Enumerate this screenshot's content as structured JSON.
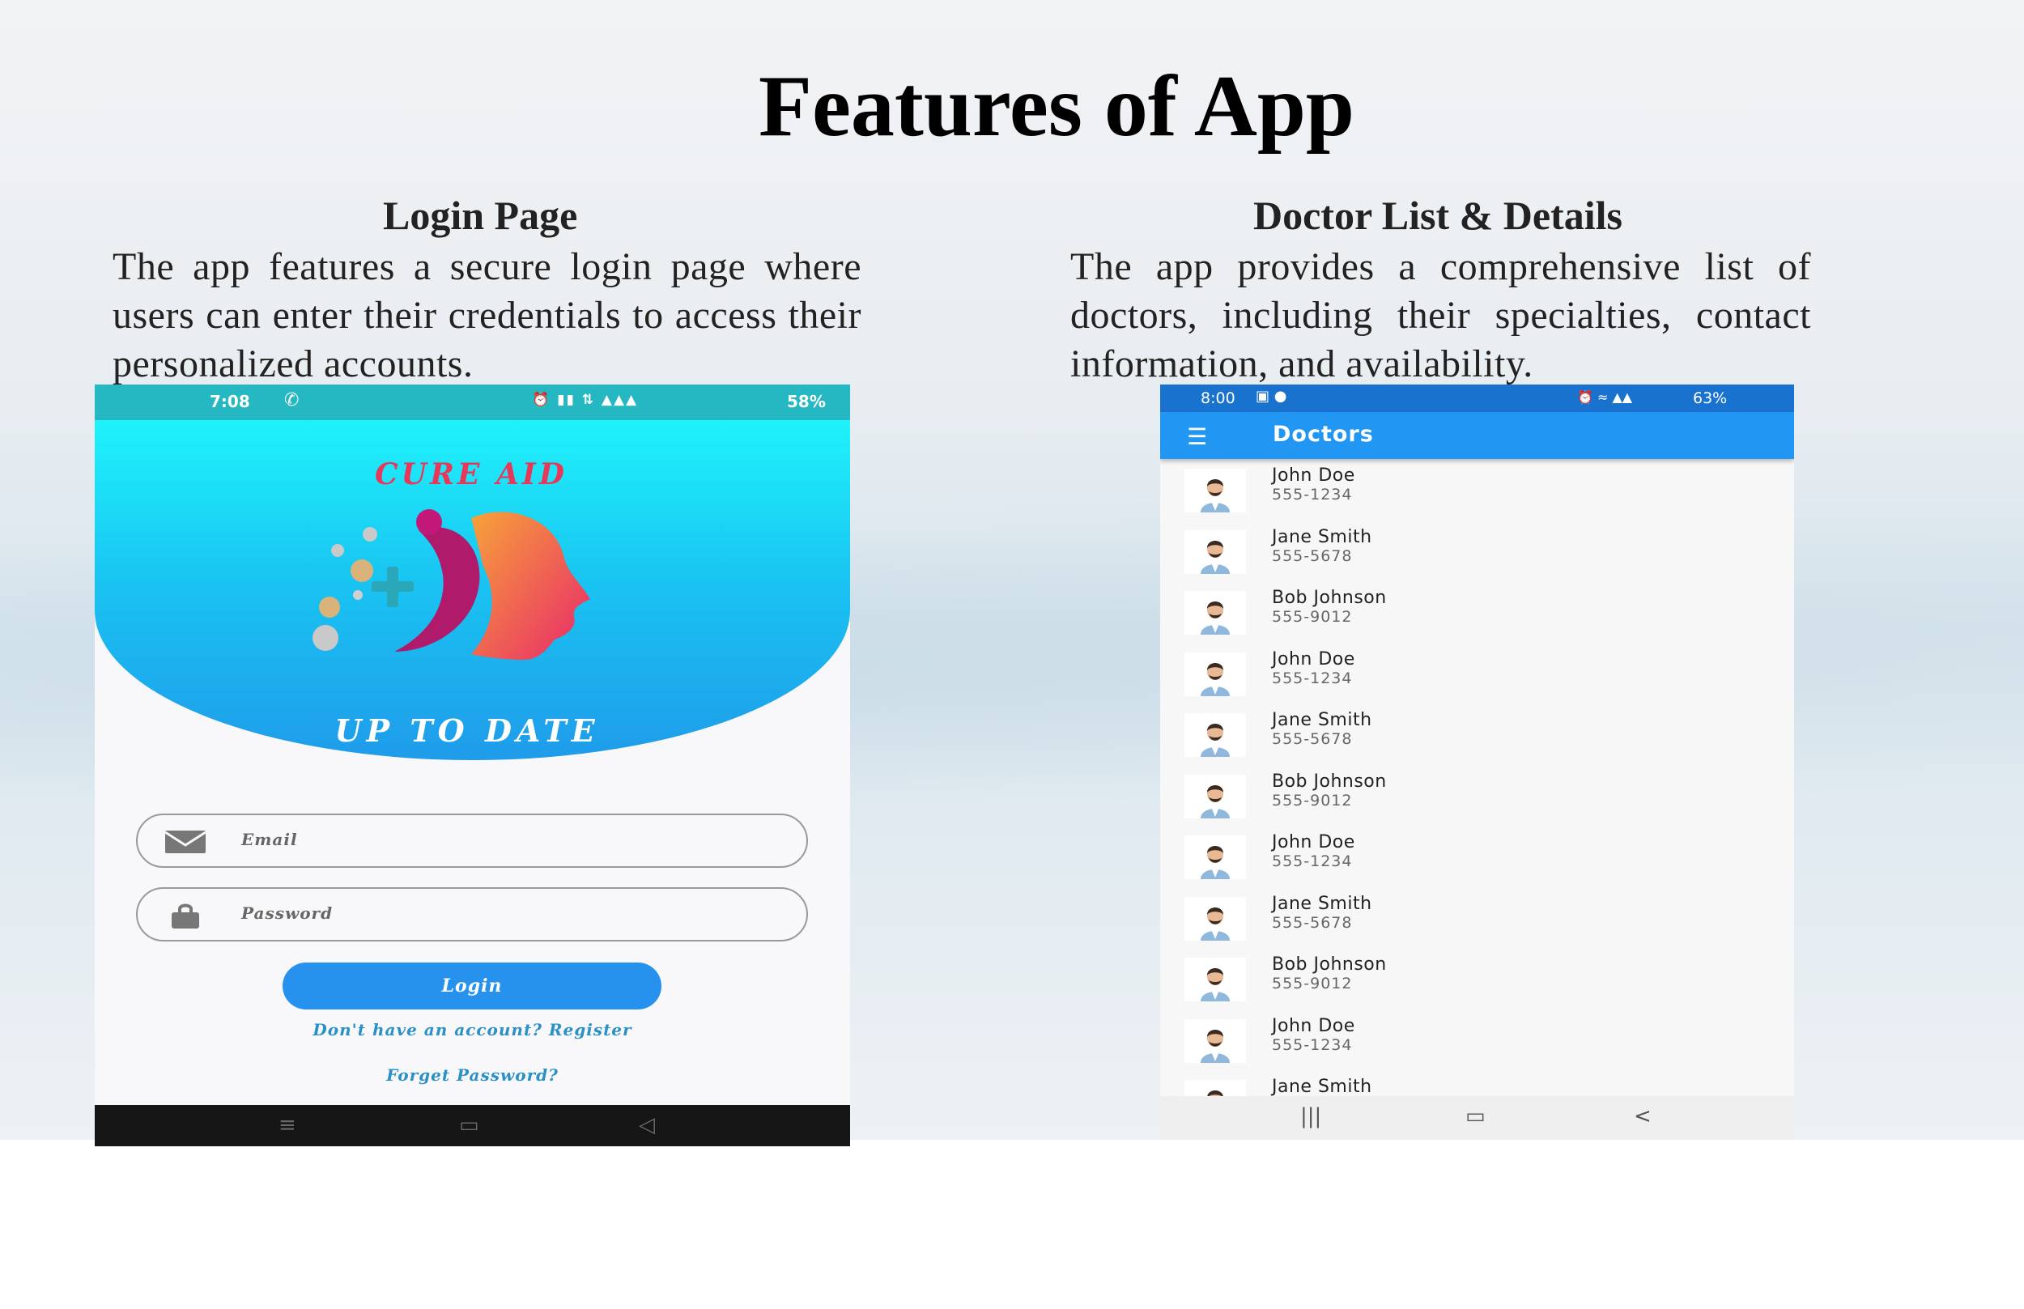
{
  "slide": {
    "title": "Features of  App",
    "login_section": {
      "heading": "Login Page",
      "description": "The app features a secure login page where users can enter their credentials to access their  personalized accounts."
    },
    "doctor_section": {
      "heading": "Doctor List & Details",
      "description": "The app provides a comprehensive list of doctors, including their  specialties, contact information, and availability."
    }
  },
  "login_screen": {
    "status_bar": {
      "time": "7:08",
      "battery": "58%",
      "icons": [
        "alarm-icon",
        "vibrate-icon",
        "data-speed-icon",
        "volte-icon",
        "signal-icon",
        "battery-icon"
      ]
    },
    "brand": "CURE AID",
    "tagline": "UP TO DATE",
    "email_placeholder": "Email",
    "password_placeholder": "Password",
    "login_label": "Login",
    "register_prompt": "Don't have an account?  Register",
    "forgot_label": "Forget Password?",
    "colors": {
      "hero_top": "#1ff3fb",
      "hero_bottom": "#1f9bea",
      "button": "#2791ee",
      "brand": "#e8385a"
    }
  },
  "doctor_screen": {
    "status_bar": {
      "time": "8:00",
      "battery": "63%"
    },
    "appbar_title": "Doctors",
    "doctors": [
      {
        "name": "John Doe",
        "phone": "555-1234"
      },
      {
        "name": "Jane Smith",
        "phone": "555-5678"
      },
      {
        "name": "Bob Johnson",
        "phone": "555-9012"
      },
      {
        "name": "John Doe",
        "phone": "555-1234"
      },
      {
        "name": "Jane Smith",
        "phone": "555-5678"
      },
      {
        "name": "Bob Johnson",
        "phone": "555-9012"
      },
      {
        "name": "John Doe",
        "phone": "555-1234"
      },
      {
        "name": "Jane Smith",
        "phone": "555-5678"
      },
      {
        "name": "Bob Johnson",
        "phone": "555-9012"
      },
      {
        "name": "John Doe",
        "phone": "555-1234"
      },
      {
        "name": "Jane Smith",
        "phone": ""
      }
    ],
    "colors": {
      "status_bar": "#1a72cf",
      "appbar": "#2196f3"
    }
  }
}
